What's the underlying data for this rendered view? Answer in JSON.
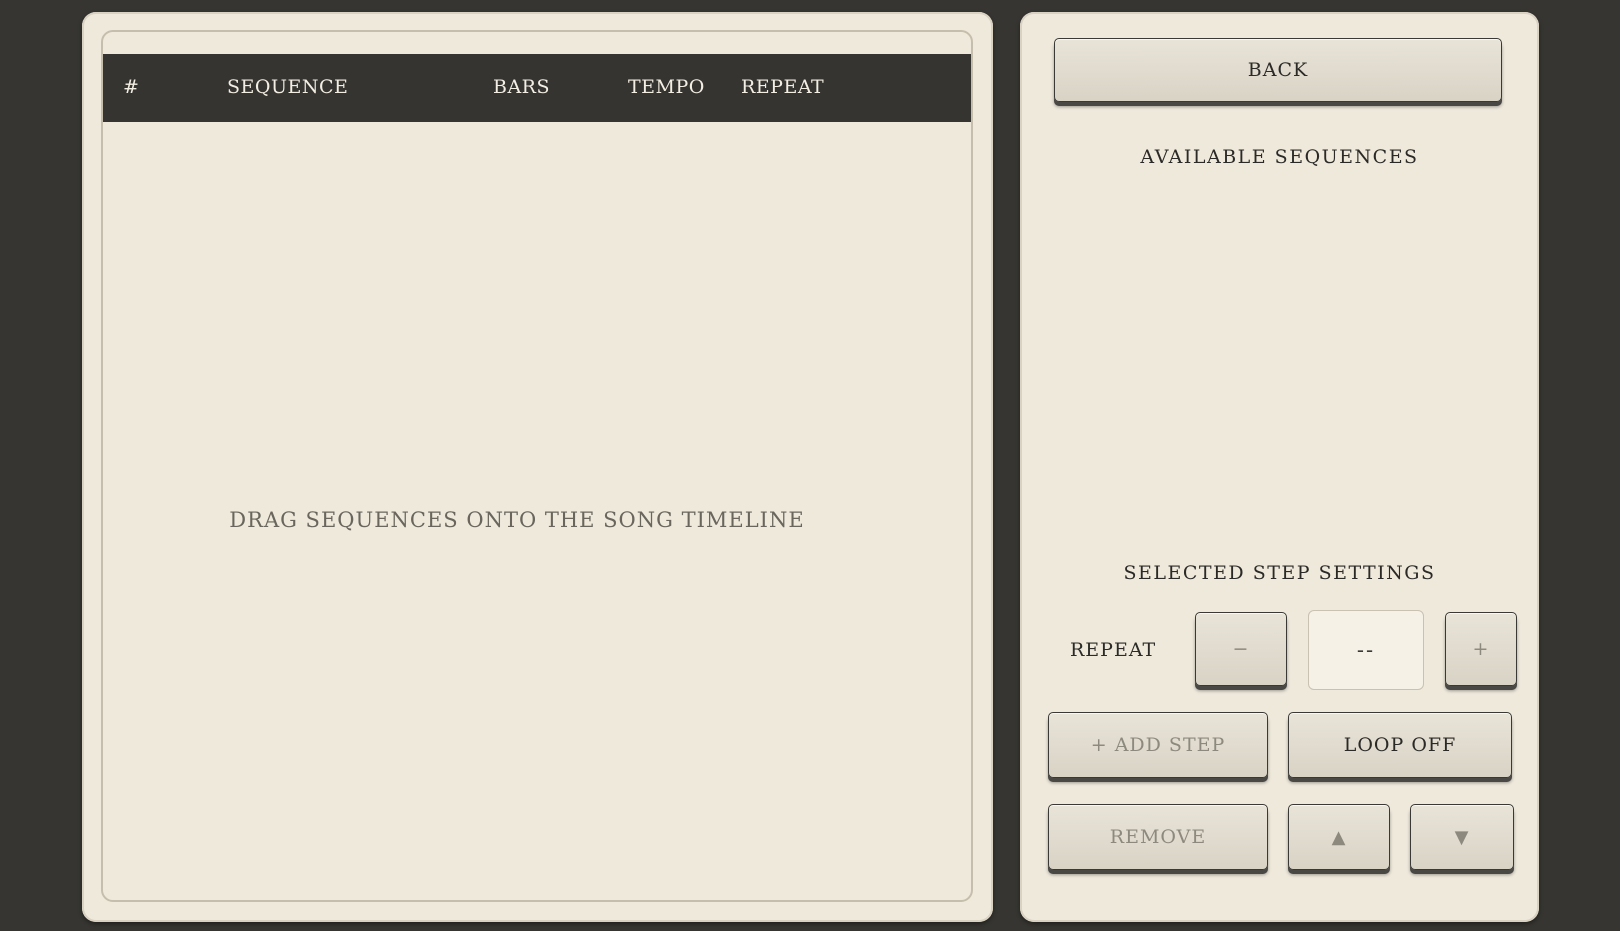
{
  "timeline": {
    "columns": {
      "index": "#",
      "sequence": "SEQUENCE",
      "bars": "BARS",
      "tempo": "TEMPO",
      "repeat": "REPEAT"
    },
    "empty_message": "DRAG SEQUENCES ONTO THE SONG TIMELINE"
  },
  "sidebar": {
    "back_label": "BACK",
    "available_title": "AVAILABLE SEQUENCES",
    "settings_title": "SELECTED STEP SETTINGS",
    "repeat_label": "REPEAT",
    "decrement_label": "−",
    "repeat_value": "--",
    "increment_label": "+",
    "add_step_label": "+ ADD STEP",
    "loop_label": "LOOP OFF",
    "remove_label": "REMOVE",
    "move_up_label": "▲",
    "move_down_label": "▼"
  }
}
